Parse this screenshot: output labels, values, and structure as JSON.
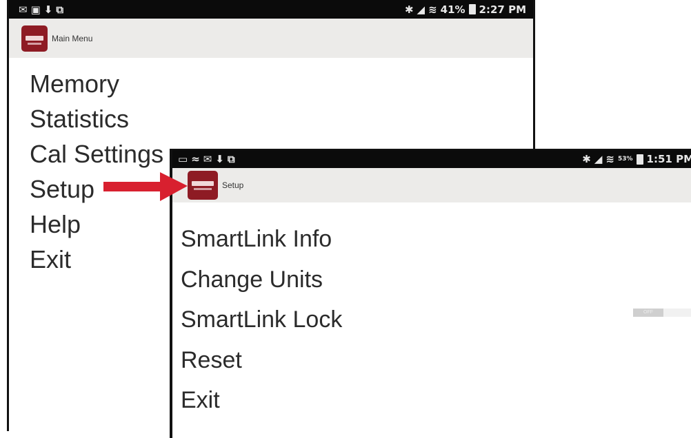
{
  "main_screen": {
    "status": {
      "time": "2:27 PM",
      "battery": "41%"
    },
    "title": "Main Menu",
    "menu": [
      {
        "label": "Memory"
      },
      {
        "label": "Statistics"
      },
      {
        "label": "Cal Settings"
      },
      {
        "label": "Setup"
      },
      {
        "label": "Help"
      },
      {
        "label": "Exit"
      }
    ]
  },
  "setup_screen": {
    "status": {
      "time": "1:51 PM",
      "battery": "53%"
    },
    "title": "Setup",
    "menu": [
      {
        "label": "SmartLink Info"
      },
      {
        "label": "Change Units"
      },
      {
        "label": "SmartLink Lock"
      },
      {
        "label": "Reset"
      },
      {
        "label": "Exit"
      }
    ],
    "lock_toggle": {
      "state": "OFF"
    }
  },
  "colors": {
    "arrow": "#d8202f",
    "app_logo": "#8e1b24",
    "status_bar": "#0b0b0b",
    "action_bar": "#ecebe9"
  }
}
